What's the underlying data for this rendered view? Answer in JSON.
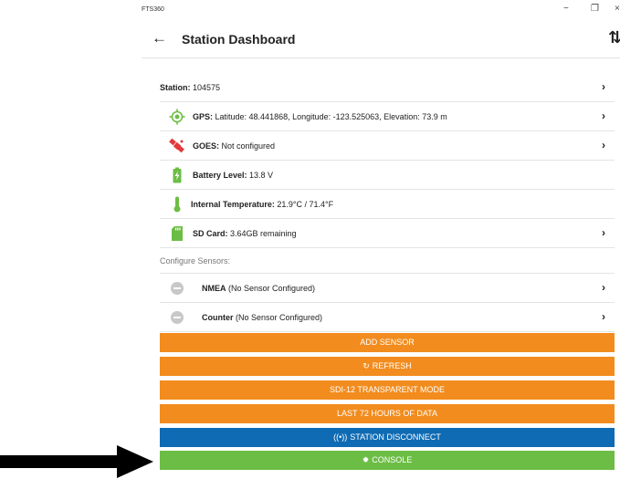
{
  "window": {
    "app_name": "FTS360",
    "minimize_glyph": "−",
    "maximize_glyph": "❐",
    "close_glyph": "×"
  },
  "header": {
    "back_glyph": "←",
    "title": "Station Dashboard",
    "sync_glyph": "⇅"
  },
  "station_rows": [
    {
      "label": "Station:",
      "value": " 104575",
      "icon": "none",
      "has_chevron": true
    },
    {
      "label": "GPS:",
      "value": " Latitude: 48.441868, Longitude: -123.525063, Elevation: 73.9 m",
      "icon": "gps-icon",
      "has_chevron": true
    },
    {
      "label": "GOES:",
      "value": " Not configured",
      "icon": "satellite-icon",
      "has_chevron": true
    },
    {
      "label": "Battery Level:",
      "value": " 13.8 V",
      "icon": "battery-icon",
      "has_chevron": false
    },
    {
      "label": "Internal Temperature:",
      "value": " 21.9°C / 71.4°F",
      "icon": "thermometer-icon",
      "has_chevron": false
    },
    {
      "label": "SD Card:",
      "value": " 3.64GB remaining",
      "icon": "sd-card-icon",
      "has_chevron": true
    }
  ],
  "configure_label": "Configure Sensors:",
  "sensor_rows": [
    {
      "name": "NMEA",
      "status": "  (No Sensor Configured)",
      "icon": "minus-circle-icon"
    },
    {
      "name": "Counter",
      "status": "  (No Sensor Configured)",
      "icon": "minus-circle-icon"
    }
  ],
  "chevron_glyph": "›",
  "buttons": {
    "add_sensor": "ADD SENSOR",
    "refresh": "REFRESH",
    "refresh_glyph": "↻",
    "sdi12": "SDI-12 TRANSPARENT MODE",
    "last72": "LAST 72 HOURS OF DATA",
    "disconnect": "STATION DISCONNECT",
    "disconnect_glyph": "((•))",
    "console": "CONSOLE",
    "console_glyph": "✹"
  },
  "colors": {
    "orange": "#f28c1e",
    "blue": "#0f6bb3",
    "green": "#6cbd45",
    "gps_green": "#6cbd45",
    "goes_red": "#e23b3b"
  }
}
